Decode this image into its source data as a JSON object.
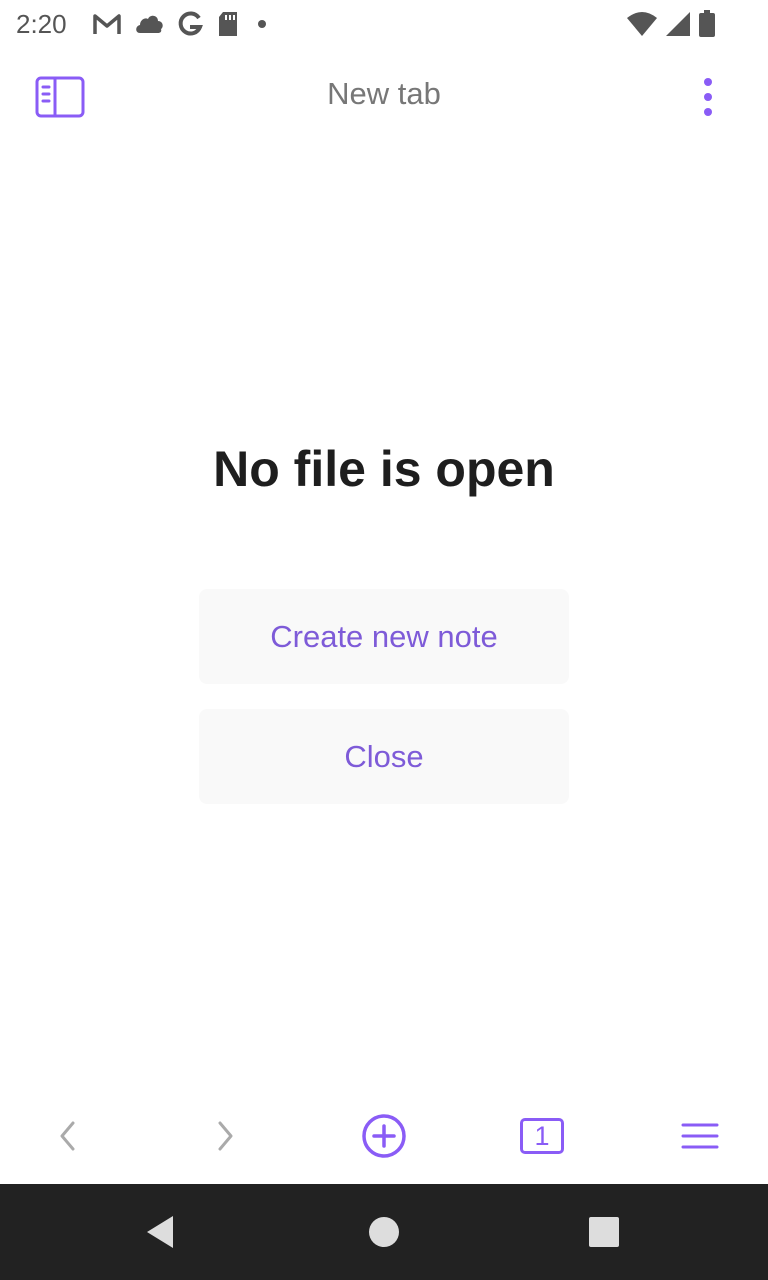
{
  "status_bar": {
    "time": "2:20",
    "left_icons": [
      "gmail-icon",
      "cloud-icon",
      "google-icon",
      "sd-card-icon",
      "dot-icon"
    ],
    "right_icons": [
      "wifi-icon",
      "signal-icon",
      "battery-icon"
    ]
  },
  "header": {
    "title": "New tab",
    "left_icon": "sidebar-toggle-icon",
    "right_icon": "more-vertical-icon"
  },
  "main": {
    "heading": "No file is open",
    "create_label": "Create new note",
    "close_label": "Close"
  },
  "toolbar": {
    "items": [
      "back-icon",
      "forward-icon",
      "new-tab-icon",
      "tab-count",
      "menu-icon"
    ],
    "tab_count": "1"
  },
  "nav": {
    "items": [
      "nav-back-icon",
      "nav-home-icon",
      "nav-recents-icon"
    ]
  },
  "colors": {
    "accent": "#8a5cf6",
    "button_text": "#7e5bd8",
    "heading": "#1e1e1e",
    "title": "#777777",
    "button_bg": "#f9f9f9",
    "nav_bar": "#222222"
  }
}
